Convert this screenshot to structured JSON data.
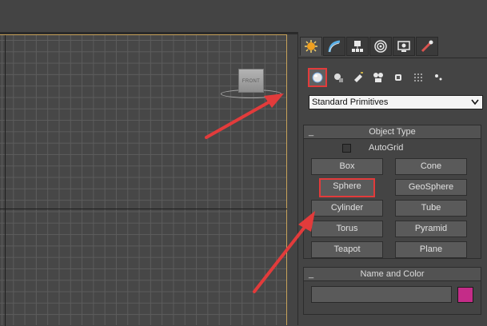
{
  "viewport": {
    "viewcube_label": "FRONT"
  },
  "panel": {
    "tabs": [
      {
        "name": "create-icon"
      },
      {
        "name": "modify-icon"
      },
      {
        "name": "hierarchy-icon"
      },
      {
        "name": "motion-icon"
      },
      {
        "name": "display-icon"
      },
      {
        "name": "utilities-icon"
      }
    ],
    "categories": [
      {
        "name": "geometry-icon"
      },
      {
        "name": "shapes-icon"
      },
      {
        "name": "lights-icon"
      },
      {
        "name": "cameras-icon"
      },
      {
        "name": "helpers-icon"
      },
      {
        "name": "space-warps-icon"
      },
      {
        "name": "systems-icon"
      }
    ],
    "dropdown_value": "Standard Primitives",
    "object_type": {
      "title": "Object Type",
      "minus": "_",
      "autogrid_label": "AutoGrid",
      "buttons": [
        "Box",
        "Cone",
        "Sphere",
        "GeoSphere",
        "Cylinder",
        "Tube",
        "Torus",
        "Pyramid",
        "Teapot",
        "Plane"
      ]
    },
    "name_color": {
      "title": "Name and Color",
      "minus": "_",
      "name_value": "",
      "color": "#c42c88"
    }
  },
  "annotation_color": "#e23b3b"
}
